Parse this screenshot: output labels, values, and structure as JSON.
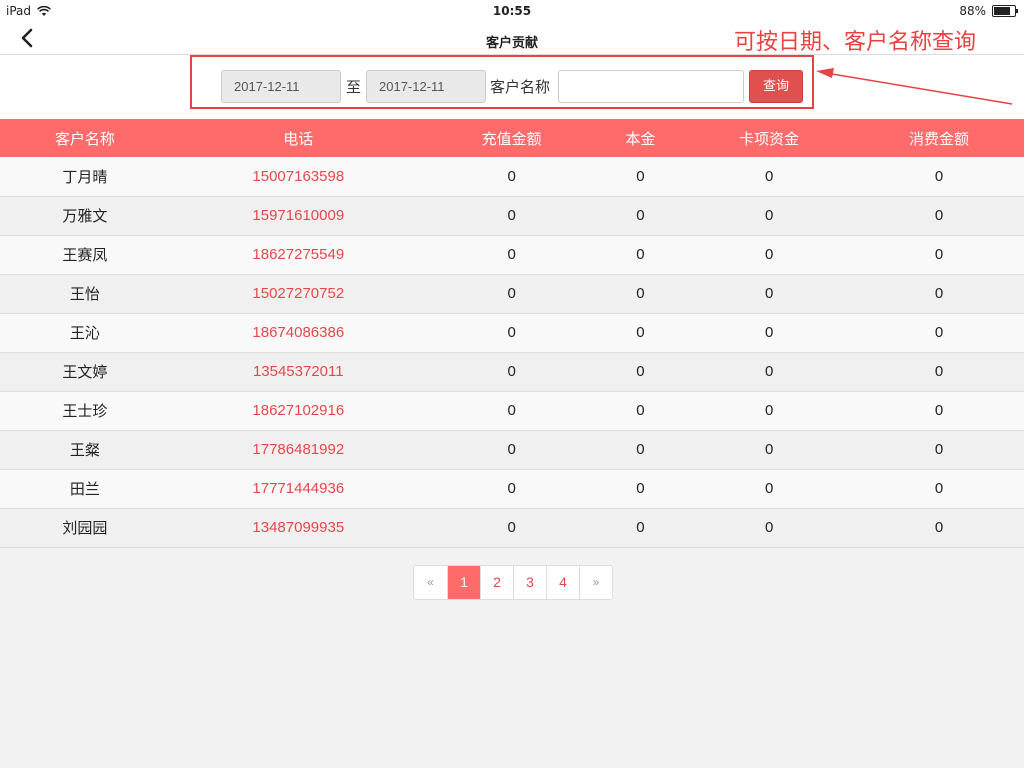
{
  "status_bar": {
    "device": "iPad",
    "time": "10:55",
    "battery": "88%",
    "battery_level": 0.88
  },
  "nav": {
    "title": "客户贡献"
  },
  "annotation": "可按日期、客户名称查询",
  "filter": {
    "start_date": "2017-12-11",
    "to_label": "至",
    "end_date": "2017-12-11",
    "name_label": "客户名称",
    "name_value": "",
    "query_label": "查询"
  },
  "table": {
    "headers": [
      "客户名称",
      "电话",
      "充值金额",
      "本金",
      "卡项资金",
      "消费金额"
    ],
    "rows": [
      [
        "丁月晴",
        "15007163598",
        "0",
        "0",
        "0",
        "0"
      ],
      [
        "万雅文",
        "15971610009",
        "0",
        "0",
        "0",
        "0"
      ],
      [
        "王赛凤",
        "18627275549",
        "0",
        "0",
        "0",
        "0"
      ],
      [
        "王怡",
        "15027270752",
        "0",
        "0",
        "0",
        "0"
      ],
      [
        "王沁",
        "18674086386",
        "0",
        "0",
        "0",
        "0"
      ],
      [
        "王文婷",
        "13545372011",
        "0",
        "0",
        "0",
        "0"
      ],
      [
        "王士珍",
        "18627102916",
        "0",
        "0",
        "0",
        "0"
      ],
      [
        "王粲",
        "17786481992",
        "0",
        "0",
        "0",
        "0"
      ],
      [
        "田兰",
        "17771444936",
        "0",
        "0",
        "0",
        "0"
      ],
      [
        "刘园园",
        "13487099935",
        "0",
        "0",
        "0",
        "0"
      ]
    ]
  },
  "pagination": {
    "prev": "«",
    "pages": [
      "1",
      "2",
      "3",
      "4"
    ],
    "next": "»",
    "active": "1"
  },
  "colors": {
    "accent": "#ff6b6b",
    "annotation": "#e84242",
    "phone": "#e8474b"
  }
}
